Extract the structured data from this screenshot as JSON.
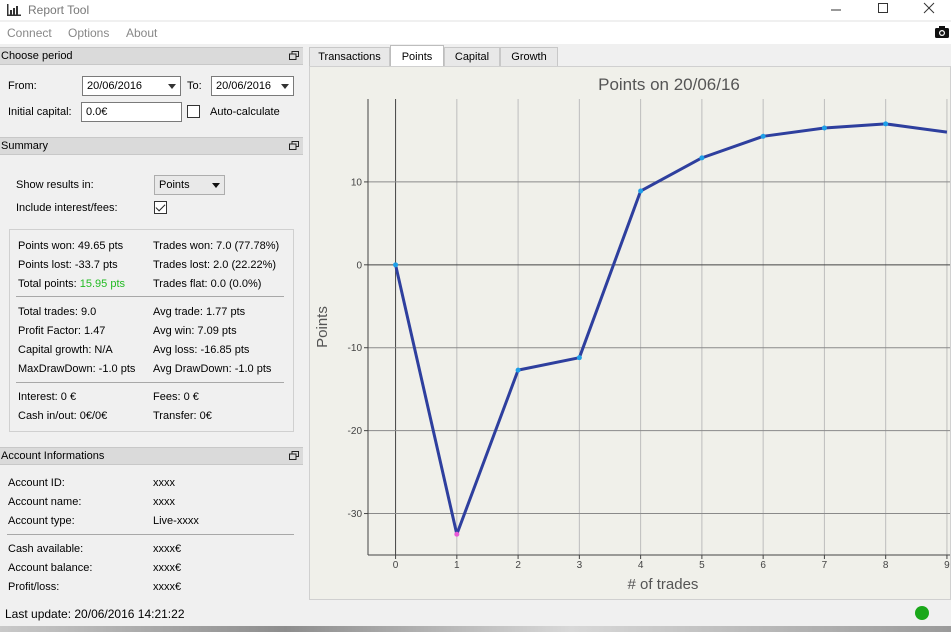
{
  "window": {
    "title": "Report Tool"
  },
  "menu": {
    "items": [
      "Connect",
      "Options",
      "About"
    ]
  },
  "period": {
    "header": "Choose period",
    "from_label": "From:",
    "from_value": "20/06/2016",
    "to_label": "To:",
    "to_value": "20/06/2016",
    "capital_label": "Initial capital:",
    "capital_value": "0.0€",
    "autocalc_label": "Auto-calculate",
    "autocalc_checked": false
  },
  "summary": {
    "header": "Summary",
    "show_label": "Show results in:",
    "show_value": "Points",
    "interest_label": "Include interest/fees:",
    "interest_checked": true,
    "points_won": "Points won: 49.65 pts",
    "points_lost": "Points lost: -33.7 pts",
    "total_points_label": "Total points:",
    "total_points_value": "15.95 pts",
    "trades_won": "Trades won: 7.0 (77.78%)",
    "trades_lost": "Trades lost: 2.0 (22.22%)",
    "trades_flat": "Trades flat: 0.0 (0.0%)",
    "total_trades": "Total trades: 9.0",
    "profit_factor": "Profit Factor: 1.47",
    "capital_growth": "Capital growth: N/A",
    "max_drawdown": "MaxDrawDown: -1.0 pts",
    "avg_trade": "Avg trade: 1.77 pts",
    "avg_win": "Avg win: 7.09 pts",
    "avg_loss": "Avg loss: -16.85 pts",
    "avg_drawdown": "Avg DrawDown: -1.0 pts",
    "interest": "Interest: 0 €",
    "fees": "Fees: 0 €",
    "cash_inout": "Cash in/out: 0€/0€",
    "transfer": "Transfer: 0€"
  },
  "account": {
    "header": "Account Informations",
    "rows": [
      {
        "label": "Account ID:",
        "value": "xxxx"
      },
      {
        "label": "Account name:",
        "value": "xxxx"
      },
      {
        "label": "Account type:",
        "value": "Live-xxxx"
      },
      {
        "label": "Cash available:",
        "value": "xxxx€"
      },
      {
        "label": "Account balance:",
        "value": "xxxx€"
      },
      {
        "label": "Profit/loss:",
        "value": "xxxx€"
      }
    ]
  },
  "tabs": [
    {
      "label": "Transactions",
      "active": false
    },
    {
      "label": "Points",
      "active": true
    },
    {
      "label": "Capital",
      "active": false
    },
    {
      "label": "Growth",
      "active": false
    }
  ],
  "status": {
    "last_update": "Last update: 20/06/2016 14:21:22",
    "connection_color": "#1aa81a"
  },
  "colors": {
    "line": "#2e3f9e",
    "marker": "#1e9fe8",
    "marker_low": "#e85ad8",
    "accent_green": "#22bb22"
  },
  "chart_data": {
    "type": "line",
    "title": "Points on 20/06/16",
    "xlabel": "# of trades",
    "ylabel": "Points",
    "x": [
      0,
      1,
      2,
      3,
      4,
      5,
      6,
      7,
      8,
      9
    ],
    "series": [
      {
        "values": [
          0,
          -32.5,
          -12.7,
          -11.2,
          8.9,
          12.9,
          15.5,
          16.5,
          17.0,
          16.0
        ]
      }
    ],
    "xlim": [
      -0.45,
      9.05
    ],
    "ylim": [
      -35,
      20
    ],
    "x_ticks": [
      0,
      1,
      2,
      3,
      4,
      5,
      6,
      7,
      8,
      9
    ],
    "y_ticks": [
      -30,
      -20,
      -10,
      0,
      10
    ],
    "grid": true,
    "legend": "none"
  }
}
